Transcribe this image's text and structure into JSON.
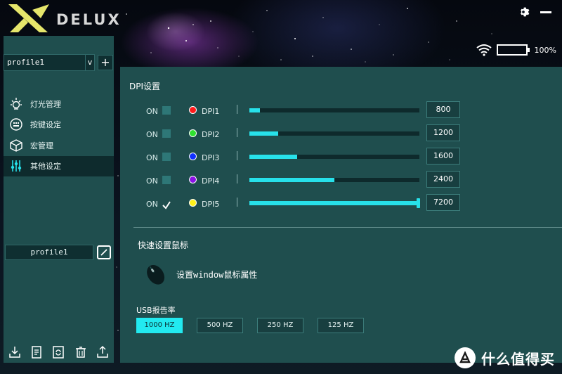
{
  "app": {
    "logo_text": "DELUX"
  },
  "status": {
    "battery_percent": "100%"
  },
  "sidebar": {
    "profile_select": "profile1",
    "select_arrow": "v",
    "add_label": "+",
    "menu": [
      {
        "label": "灯光管理",
        "icon": "bulb-icon"
      },
      {
        "label": "按键设定",
        "icon": "keyboard-icon"
      },
      {
        "label": "宏管理",
        "icon": "cube-icon"
      },
      {
        "label": "其他设定",
        "icon": "sliders-icon",
        "active": true
      }
    ],
    "profile_name": "profile1"
  },
  "dpi": {
    "title": "DPI设置",
    "rows": [
      {
        "on": "ON",
        "checked": false,
        "color": "#ff1a1a",
        "name": "DPI1",
        "value": "800",
        "fraction": 0.06
      },
      {
        "on": "ON",
        "checked": false,
        "color": "#2fe02f",
        "name": "DPI2",
        "value": "1200",
        "fraction": 0.17
      },
      {
        "on": "ON",
        "checked": false,
        "color": "#1030ff",
        "name": "DPI3",
        "value": "1600",
        "fraction": 0.28
      },
      {
        "on": "ON",
        "checked": false,
        "color": "#8a12e6",
        "name": "DPI4",
        "value": "2400",
        "fraction": 0.5
      },
      {
        "on": "ON",
        "checked": true,
        "color": "#fff21a",
        "name": "DPI5",
        "value": "7200",
        "fraction": 1.0
      }
    ]
  },
  "quick": {
    "title": "快速设置鼠标",
    "item_label": "设置window鼠标属性"
  },
  "usb": {
    "title": "USB报告率",
    "options": [
      "1000 HZ",
      "500 HZ",
      "250 HZ",
      "125 HZ"
    ],
    "selected": "1000 HZ"
  },
  "watermark": {
    "text": "什么值得买",
    "logo_char": "值"
  }
}
